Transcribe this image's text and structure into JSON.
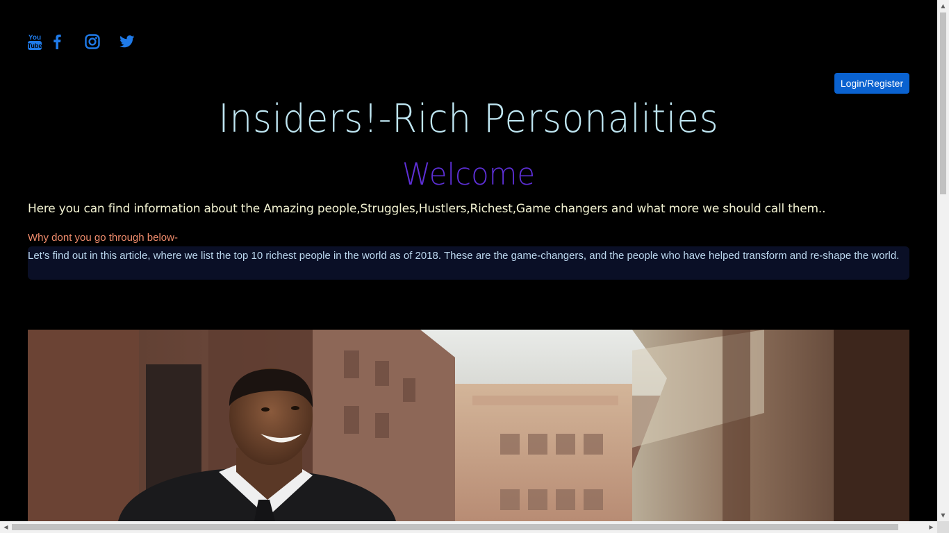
{
  "social": {
    "icons": [
      "youtube-icon",
      "facebook-icon",
      "instagram-icon",
      "twitter-icon"
    ],
    "icon_color": "#1f7ae8"
  },
  "header": {
    "login_label": "Login/Register",
    "login_color": "#0a62d0"
  },
  "main": {
    "title": "Insiders!-Rich Personalities",
    "welcome": "Welcome",
    "intro": "Here you can find information about the Amazing people,Struggles,Hustlers,Richest,Game changers and what more we should call them..",
    "why": "Why dont you go through below-",
    "article": "Let’s find out in this article, where we list the top 10 richest people in the world as of 2018. These are the game-changers, and the people who have helped transform and re-shape the world."
  },
  "colors": {
    "background": "#000000",
    "title": "#bfe6f2",
    "welcome": "#5d2fd6",
    "intro": "#f0f0d0",
    "why": "#f08c6c",
    "article_bg": "#0a0f26",
    "article_text": "#bcd8ef"
  }
}
